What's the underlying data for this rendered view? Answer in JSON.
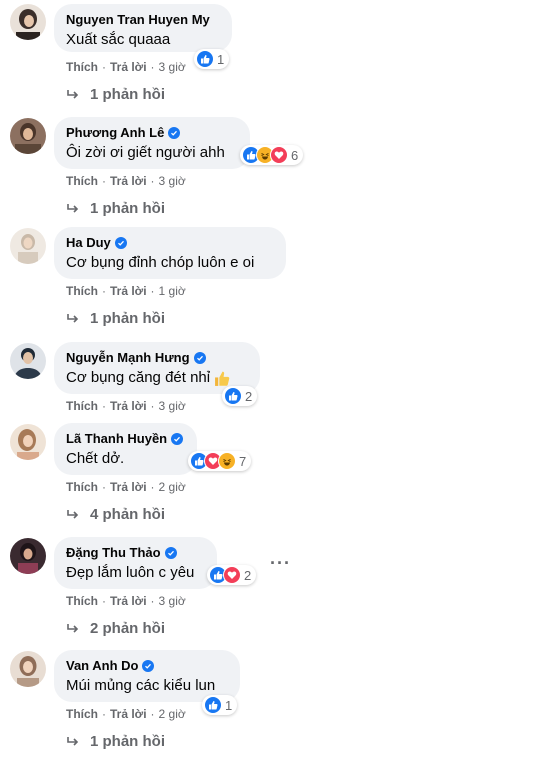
{
  "labels": {
    "like": "Thích",
    "reply": "Trả lời",
    "dot": "·"
  },
  "comments": [
    {
      "author": "Nguyen Tran Huyen My",
      "verified": false,
      "text": "Xuất sắc quaaa",
      "reactions": [
        "like"
      ],
      "count": "1",
      "time": "3 giờ",
      "replies": "1 phản hồi",
      "avatar_color": "#3a2e2a"
    },
    {
      "author": "Phương Anh Lê",
      "verified": true,
      "text": "Ôi zời ơi giết người ahh",
      "reactions": [
        "like",
        "haha",
        "love"
      ],
      "count": "6",
      "time": "3 giờ",
      "replies": "1 phản hồi",
      "avatar_color": "#6b5343"
    },
    {
      "author": "Ha Duy",
      "verified": true,
      "text": "Cơ bụng đỉnh chóp luôn e oi",
      "reactions": [],
      "count": "",
      "time": "1 giờ",
      "replies": "1 phản hồi",
      "avatar_color": "#d8cfc4"
    },
    {
      "author": "Nguyễn Mạnh Hưng",
      "verified": true,
      "text": "Cơ bụng căng đét nhỉ",
      "emoji": "thumbs-up-emoji",
      "reactions": [
        "like"
      ],
      "count": "2",
      "time": "3 giờ",
      "replies": "",
      "avatar_color": "#2c3a4a"
    },
    {
      "author": "Lã Thanh Huyền",
      "verified": true,
      "text": "Chết dở.",
      "reactions": [
        "like",
        "love",
        "haha"
      ],
      "count": "7",
      "time": "2 giờ",
      "replies": "4 phản hồi",
      "avatar_color": "#c49a7a"
    },
    {
      "author": "Đặng Thu Thảo",
      "verified": true,
      "text": "Đẹp lắm luôn c yêu",
      "reactions": [
        "like",
        "love"
      ],
      "count": "2",
      "time": "3 giờ",
      "replies": "2 phản hồi",
      "more": "···",
      "avatar_color": "#7a3b4c"
    },
    {
      "author": "Van Anh Do",
      "verified": true,
      "text": "Múi mủng các kiểu lun",
      "reactions": [
        "like"
      ],
      "count": "1",
      "time": "2 giờ",
      "replies": "1 phản hồi",
      "avatar_color": "#b59a86"
    }
  ]
}
